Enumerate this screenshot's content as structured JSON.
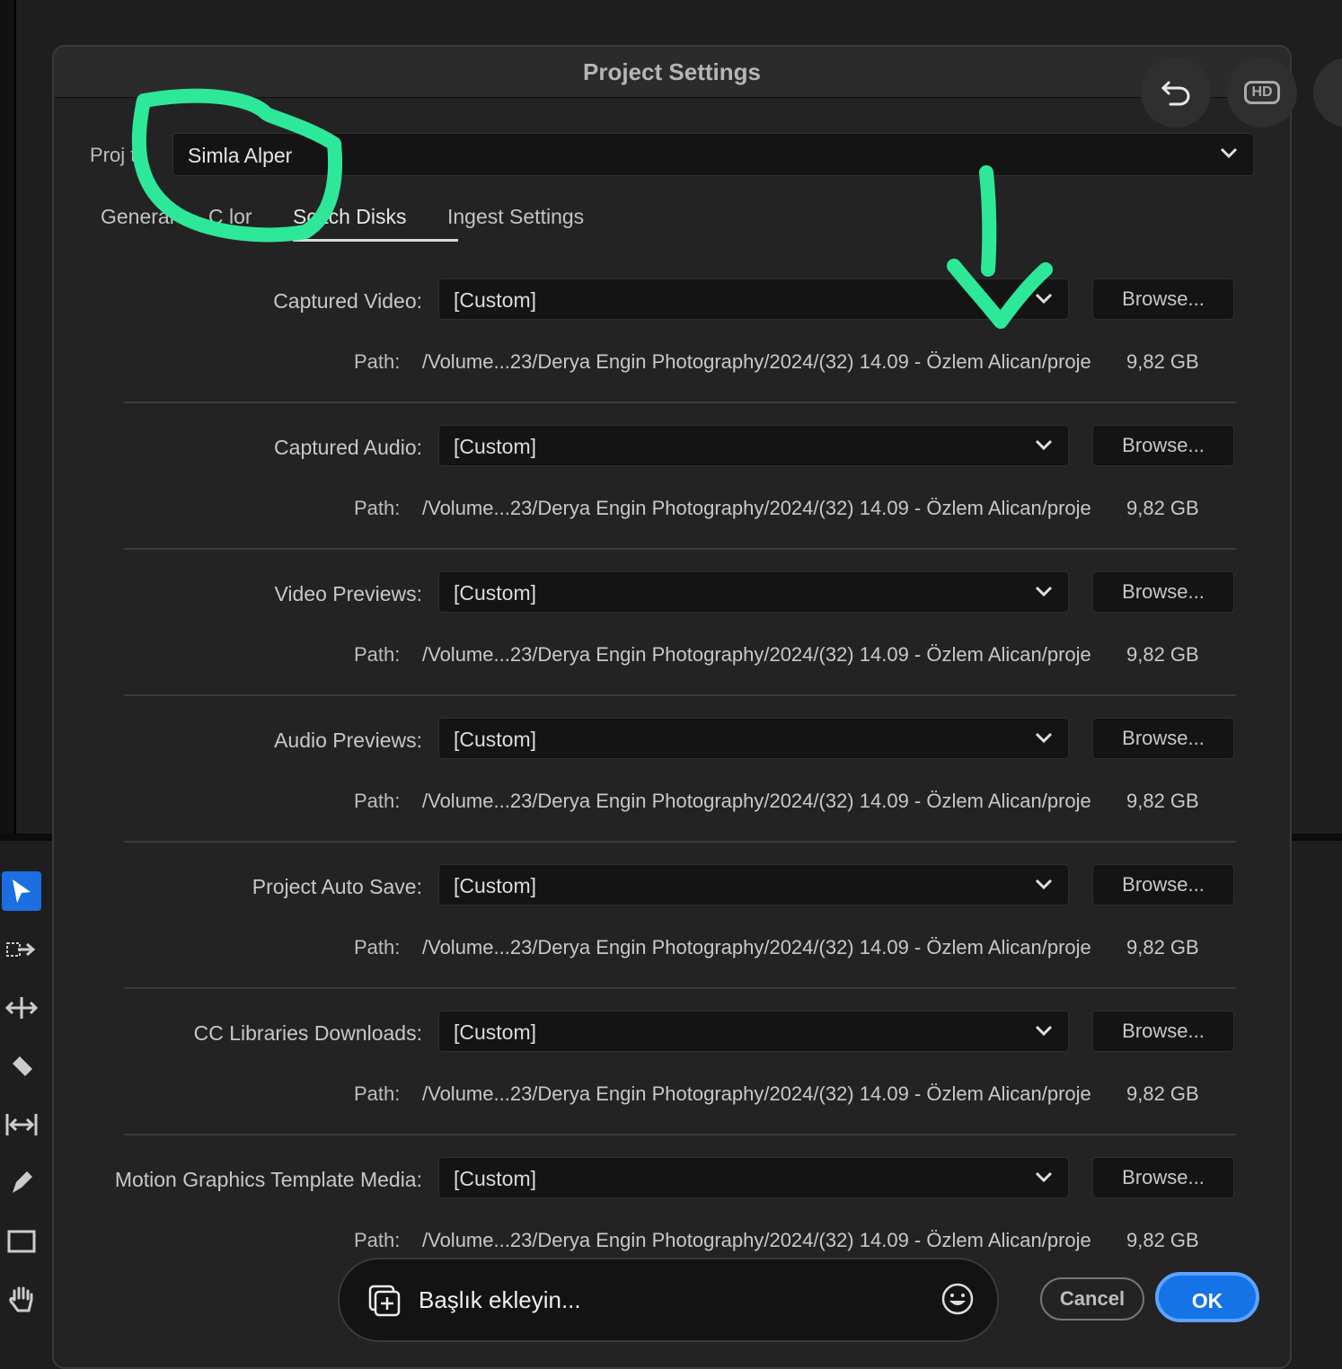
{
  "dialog": {
    "title": "Project Settings",
    "project_label": "Proj    t:",
    "project_value": "Simla Alper",
    "tabs": [
      {
        "label": "General",
        "active": false
      },
      {
        "label": "C   lor",
        "active": false
      },
      {
        "label": "Sc    tch Disks",
        "active": true
      },
      {
        "label": "Ingest Settings",
        "active": false
      }
    ],
    "rows": [
      {
        "label": "Captured Video:",
        "value": "[Custom]",
        "browse": "Browse...",
        "path_label": "Path:",
        "path": "/Volume...23/Derya Engin Photography/2024/(32) 14.09 - Özlem Alican/proje",
        "size": "9,82 GB"
      },
      {
        "label": "Captured Audio:",
        "value": "[Custom]",
        "browse": "Browse...",
        "path_label": "Path:",
        "path": "/Volume...23/Derya Engin Photography/2024/(32) 14.09 - Özlem Alican/proje",
        "size": "9,82 GB"
      },
      {
        "label": "Video Previews:",
        "value": "[Custom]",
        "browse": "Browse...",
        "path_label": "Path:",
        "path": "/Volume...23/Derya Engin Photography/2024/(32) 14.09 - Özlem Alican/proje",
        "size": "9,82 GB"
      },
      {
        "label": "Audio Previews:",
        "value": "[Custom]",
        "browse": "Browse...",
        "path_label": "Path:",
        "path": "/Volume...23/Derya Engin Photography/2024/(32) 14.09 - Özlem Alican/proje",
        "size": "9,82 GB"
      },
      {
        "label": "Project Auto Save:",
        "value": "[Custom]",
        "browse": "Browse...",
        "path_label": "Path:",
        "path": "/Volume...23/Derya Engin Photography/2024/(32) 14.09 - Özlem Alican/proje",
        "size": "9,82 GB"
      },
      {
        "label": "CC Libraries Downloads:",
        "value": "[Custom]",
        "browse": "Browse...",
        "path_label": "Path:",
        "path": "/Volume...23/Derya Engin Photography/2024/(32) 14.09 - Özlem Alican/proje",
        "size": "9,82 GB"
      },
      {
        "label": "Motion Graphics Template Media:",
        "value": "[Custom]",
        "browse": "Browse...",
        "path_label": "Path:",
        "path": "/Volume...23/Derya Engin Photography/2024/(32) 14.09 - Özlem Alican/proje",
        "size": "9,82 GB"
      }
    ],
    "cancel": "Cancel",
    "ok": "OK"
  },
  "overlay": {
    "undo_icon": "undo-icon",
    "hd_badge": "HD",
    "caption_placeholder": "Başlık ekleyin...",
    "annotation_color": "#2ee89a"
  },
  "toolbar": {
    "tools": [
      "selection-icon",
      "track-select-icon",
      "ripple-edit-icon",
      "razor-icon",
      "slip-icon",
      "pen-icon",
      "rectangle-icon",
      "hand-icon"
    ]
  },
  "colors": {
    "accent": "#1473e6",
    "annotation": "#2ee89a"
  }
}
